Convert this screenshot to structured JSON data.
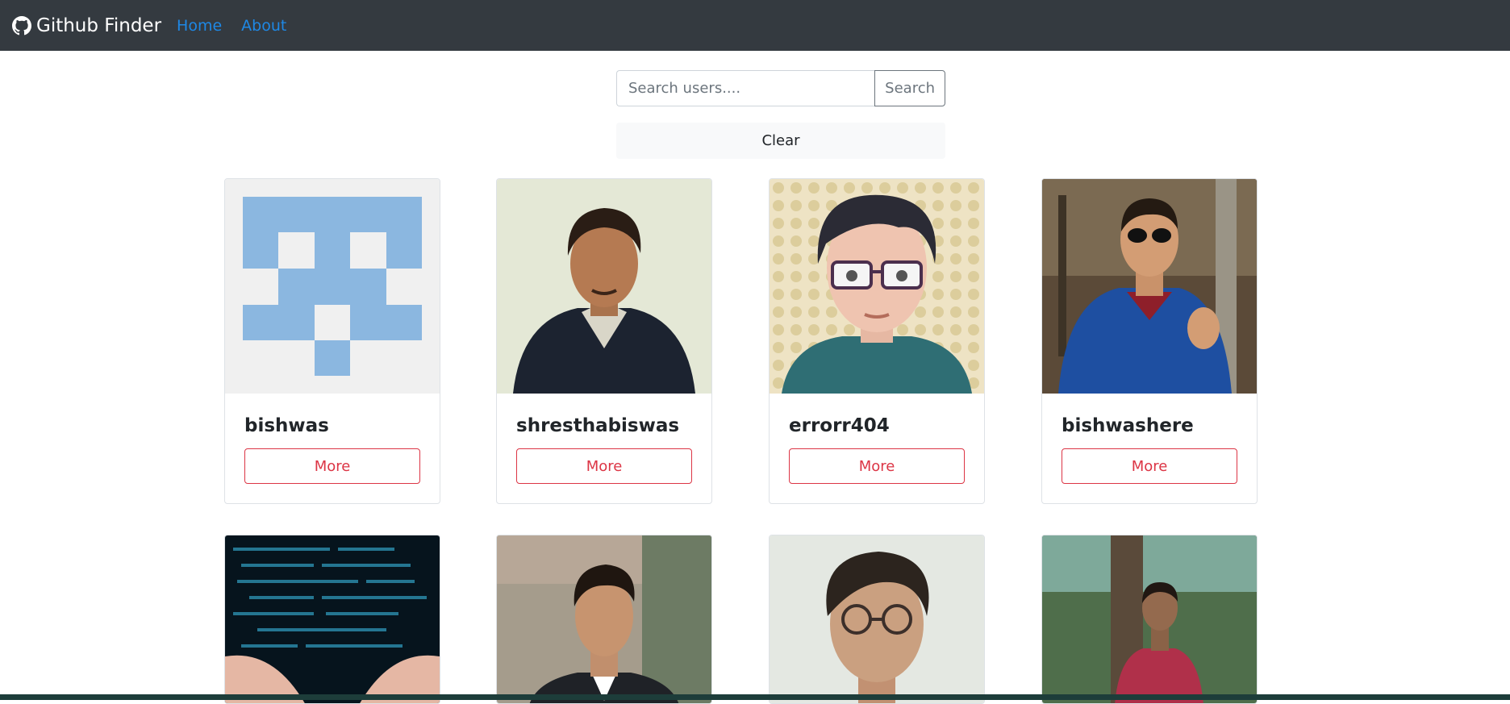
{
  "navbar": {
    "brand": "Github Finder",
    "links": [
      "Home",
      "About"
    ]
  },
  "search": {
    "placeholder": "Search users....",
    "button_label": "Search",
    "clear_label": "Clear"
  },
  "users": [
    {
      "login": "bishwas",
      "button": "More"
    },
    {
      "login": "shresthabiswas",
      "button": "More"
    },
    {
      "login": "errorr404",
      "button": "More"
    },
    {
      "login": "bishwashere",
      "button": "More"
    }
  ],
  "colors": {
    "navbar": "#343a40",
    "link": "#1e88e5",
    "danger": "#dc3545"
  }
}
